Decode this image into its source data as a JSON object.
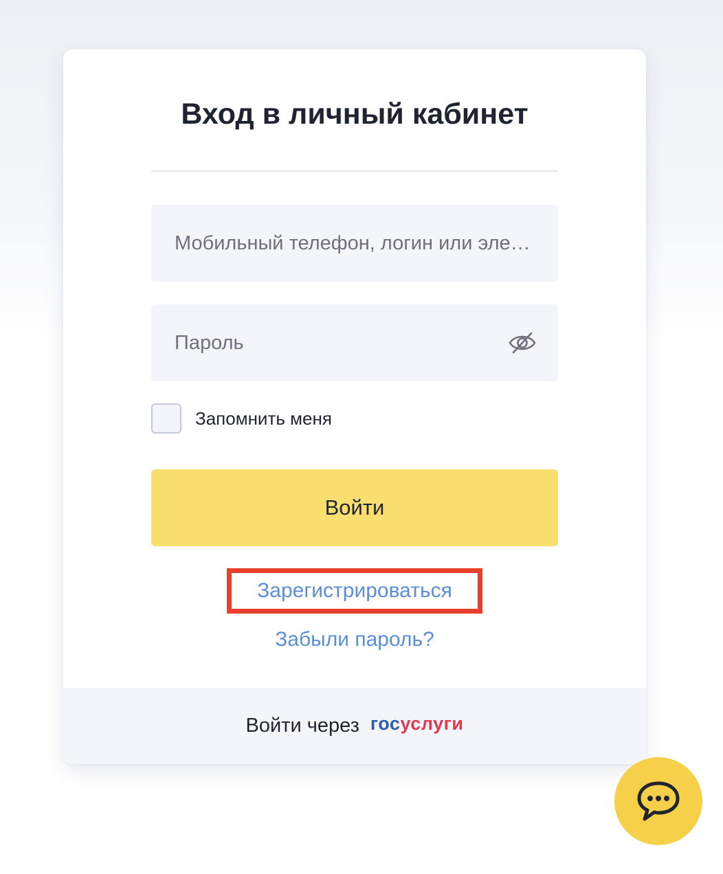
{
  "login_card": {
    "title": "Вход в личный кабинет",
    "login_field": {
      "placeholder": "Мобильный телефон, логин или электронная почта",
      "value": ""
    },
    "password_field": {
      "placeholder": "Пароль",
      "value": "",
      "toggle_icon": "eye-off-icon"
    },
    "remember_me": {
      "label": "Запомнить меня",
      "checked": false
    },
    "submit_label": "Войти",
    "register_link": "Зарегистрироваться",
    "forgot_link": "Забыли пароль?",
    "footer": {
      "text": "Войти через",
      "provider_logo": {
        "part1": "гос",
        "part2": "услуги"
      }
    }
  },
  "chat_widget": {
    "icon": "chat-bubble-icon"
  },
  "colors": {
    "accent_button": "#f9df6f",
    "link": "#5a8fd8",
    "highlight_box": "#e8402c",
    "chat_button": "#f6d048",
    "gosuslugi_blue": "#2c5fa8",
    "gosuslugi_red": "#e03a4e"
  }
}
